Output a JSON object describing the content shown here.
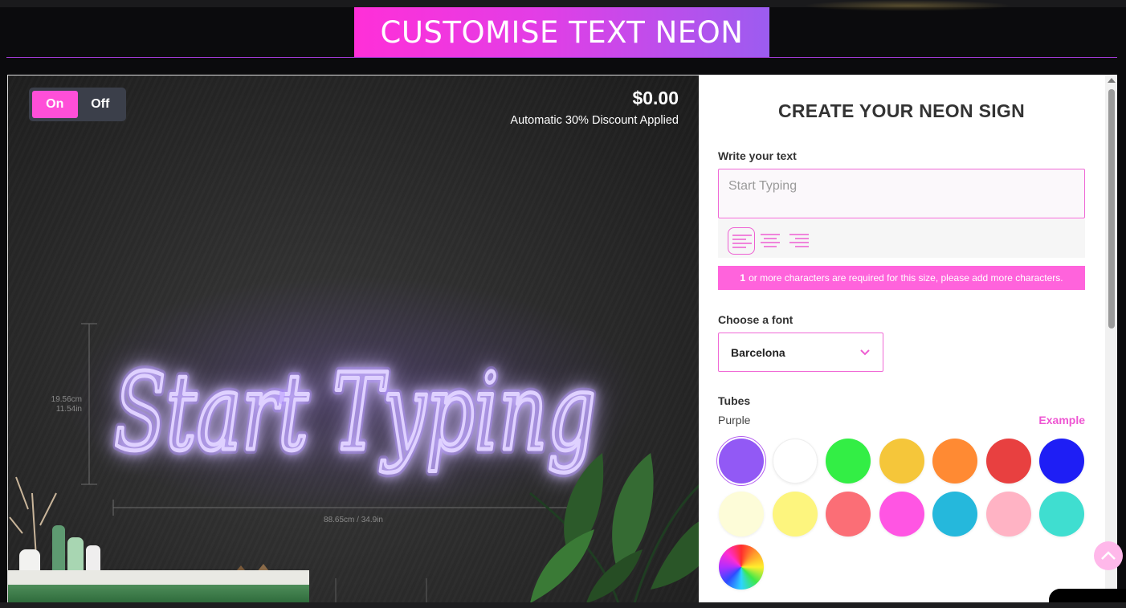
{
  "banner": {
    "title": "CUSTOMISE TEXT NEON"
  },
  "preview": {
    "toggle": {
      "on_label": "On",
      "off_label": "Off"
    },
    "price": "$0.00",
    "discount": "Automatic 30% Discount Applied",
    "neon_text": "Start Typing",
    "neon_color": "#a47bff",
    "height_cm": "19.56cm",
    "height_in": "11.54in",
    "width_label": "88.65cm / 34.9in"
  },
  "panel": {
    "title": "CREATE YOUR NEON SIGN",
    "write_label": "Write your text",
    "text_placeholder": "Start Typing",
    "text_value": "",
    "align_options": [
      "align-left-icon",
      "align-center-icon",
      "align-right-icon"
    ],
    "warning_count": "1",
    "warning_text": "or more characters are required for this size, please add more characters.",
    "font_label": "Choose a font",
    "font_value": "Barcelona",
    "tubes_label": "Tubes",
    "tube_selected": "Purple",
    "example_link": "Example",
    "swatches": [
      {
        "name": "Purple",
        "color": "#9259f5"
      },
      {
        "name": "White",
        "color": "#ffffff"
      },
      {
        "name": "Green",
        "color": "#33ee45"
      },
      {
        "name": "Golden Yellow",
        "color": "#f5c63a"
      },
      {
        "name": "Orange",
        "color": "#ff8a33"
      },
      {
        "name": "Red",
        "color": "#e84040"
      },
      {
        "name": "Blue",
        "color": "#1e1ef5"
      },
      {
        "name": "Warm White",
        "color": "#fdfcd8"
      },
      {
        "name": "Lemon Yellow",
        "color": "#fdf57e"
      },
      {
        "name": "Coral",
        "color": "#fb6e76"
      },
      {
        "name": "Pink",
        "color": "#ff55e3"
      },
      {
        "name": "Ice Blue",
        "color": "#25b8dc"
      },
      {
        "name": "Light Pink",
        "color": "#ffb3c4"
      },
      {
        "name": "Aqua",
        "color": "#3fded0"
      },
      {
        "name": "RGB",
        "color": "conic"
      }
    ]
  }
}
